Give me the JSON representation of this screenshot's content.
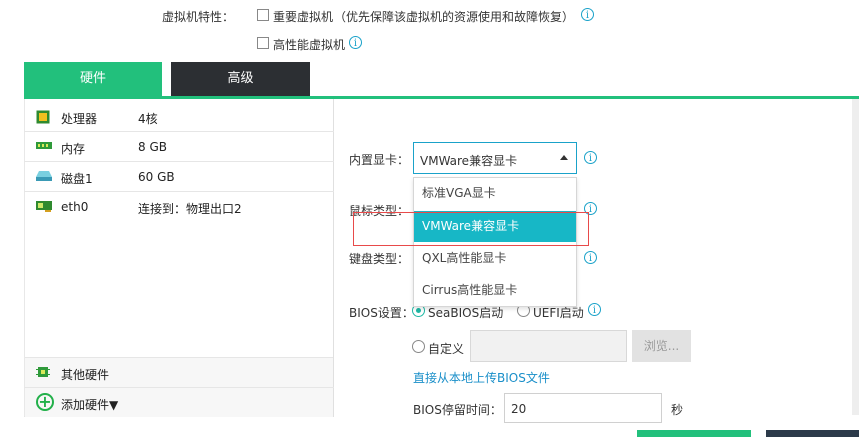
{
  "vm_features": {
    "label": "虚拟机特性：",
    "important_vm_label": "重要虚拟机",
    "important_vm_hint": "（优先保障该虚拟机的资源使用和故障恢复）",
    "high_perf_vm_label": "高性能虚拟机"
  },
  "tabs": [
    {
      "label": "硬件",
      "active": true
    },
    {
      "label": "高级",
      "active": false
    }
  ],
  "hardware": [
    {
      "name": "处理器",
      "value": "4核",
      "icon": "cpu-icon"
    },
    {
      "name": "内存",
      "value": "8 GB",
      "icon": "memory-icon"
    },
    {
      "name": "磁盘1",
      "value": "60 GB",
      "icon": "disk-icon"
    },
    {
      "name": "eth0",
      "value": "连接到：物理出口2",
      "icon": "network-card-icon"
    }
  ],
  "other_hardware_label": "其他硬件",
  "add_hardware_label": "添加硬件▼",
  "form": {
    "gpu_label": "内置显卡：",
    "gpu_selected": "VMWare兼容显卡",
    "gpu_options": [
      "标准VGA显卡",
      "VMWare兼容显卡",
      "QXL高性能显卡",
      "Cirrus高性能显卡"
    ],
    "mouse_label": "鼠标类型：",
    "keyboard_label": "键盘类型：",
    "bios_label": "BIOS设置：",
    "bios_seabios": "SeaBIOS启动",
    "bios_uefi": "UEFI启动",
    "bios_custom": "自定义",
    "browse_label": "浏览...",
    "upload_link": "直接从本地上传BIOS文件",
    "bios_delay_label": "BIOS停留时间：",
    "bios_delay_value": "20",
    "bios_delay_unit": "秒"
  },
  "colors": {
    "accent": "#22c07c",
    "dark_tab": "#2c2f33",
    "highlight": "#17b7c6",
    "annotation_box": "#e84a4a"
  }
}
